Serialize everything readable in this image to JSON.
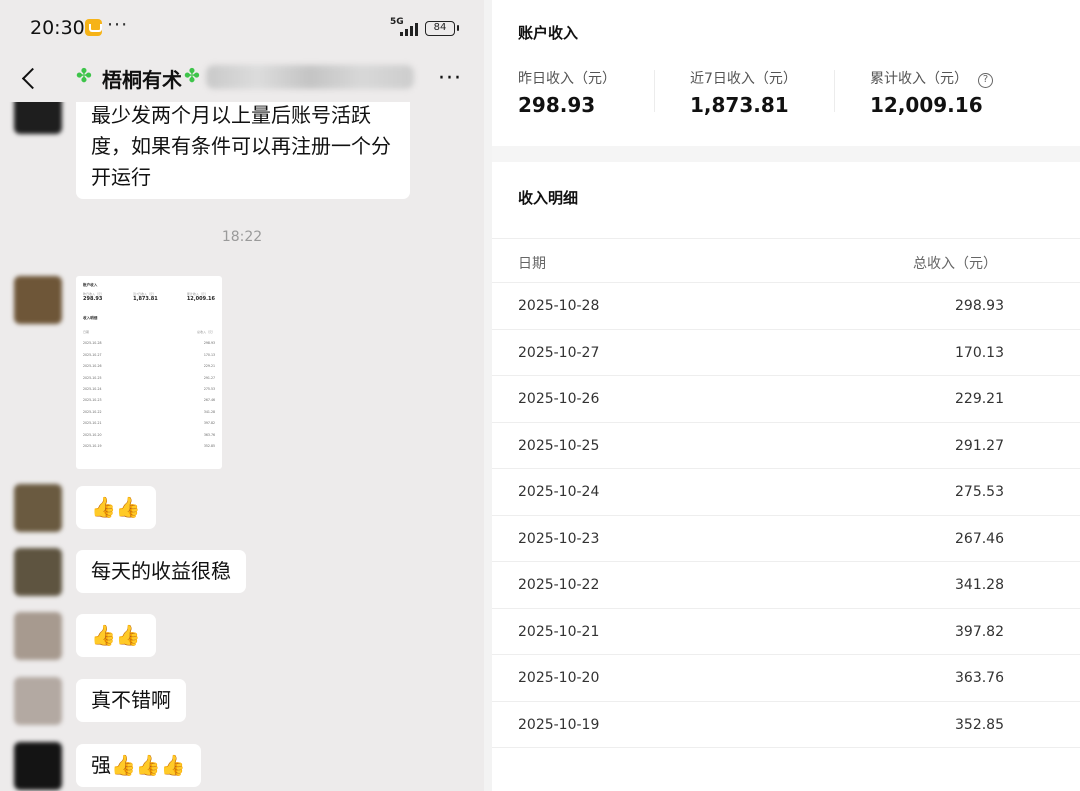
{
  "status_bar": {
    "time": "20:30",
    "more": "···",
    "network": "5G",
    "battery": "84"
  },
  "chat": {
    "title": "梧桐有术",
    "messages": [
      {
        "type": "text",
        "lines": [
          "最少发两个月以上量后账号活跃",
          "度，如果有条件可以再注册一个分",
          "开运行"
        ]
      },
      {
        "type": "timestamp",
        "text": "18:22"
      },
      {
        "type": "image"
      },
      {
        "type": "text",
        "text": "👍👍"
      },
      {
        "type": "text",
        "text": "每天的收益很稳"
      },
      {
        "type": "text",
        "text": "👍👍"
      },
      {
        "type": "text",
        "text": "真不错啊"
      },
      {
        "type": "text",
        "text": "强👍👍👍"
      }
    ]
  },
  "income": {
    "summary_title": "账户收入",
    "stats": [
      {
        "label": "昨日收入（元）",
        "value": "298.93"
      },
      {
        "label": "近7日收入（元）",
        "value": "1,873.81"
      },
      {
        "label": "累计收入（元）",
        "value": "12,009.16"
      }
    ],
    "help_icon": "?",
    "detail_title": "收入明细",
    "columns": {
      "date": "日期",
      "amount": "总收入（元）"
    },
    "rows": [
      {
        "date": "2025-10-28",
        "amount": "298.93"
      },
      {
        "date": "2025-10-27",
        "amount": "170.13"
      },
      {
        "date": "2025-10-26",
        "amount": "229.21"
      },
      {
        "date": "2025-10-25",
        "amount": "291.27"
      },
      {
        "date": "2025-10-24",
        "amount": "275.53"
      },
      {
        "date": "2025-10-23",
        "amount": "267.46"
      },
      {
        "date": "2025-10-22",
        "amount": "341.28"
      },
      {
        "date": "2025-10-21",
        "amount": "397.82"
      },
      {
        "date": "2025-10-20",
        "amount": "363.76"
      },
      {
        "date": "2025-10-19",
        "amount": "352.85"
      }
    ]
  },
  "colors": {
    "accent_green": "#3ec44a",
    "thumbs_yellow": "#e7a928"
  },
  "icons": [
    "back-arrow-icon",
    "clover-icon",
    "menu-dots-icon",
    "signal-icon",
    "battery-icon",
    "help-circle-icon"
  ]
}
